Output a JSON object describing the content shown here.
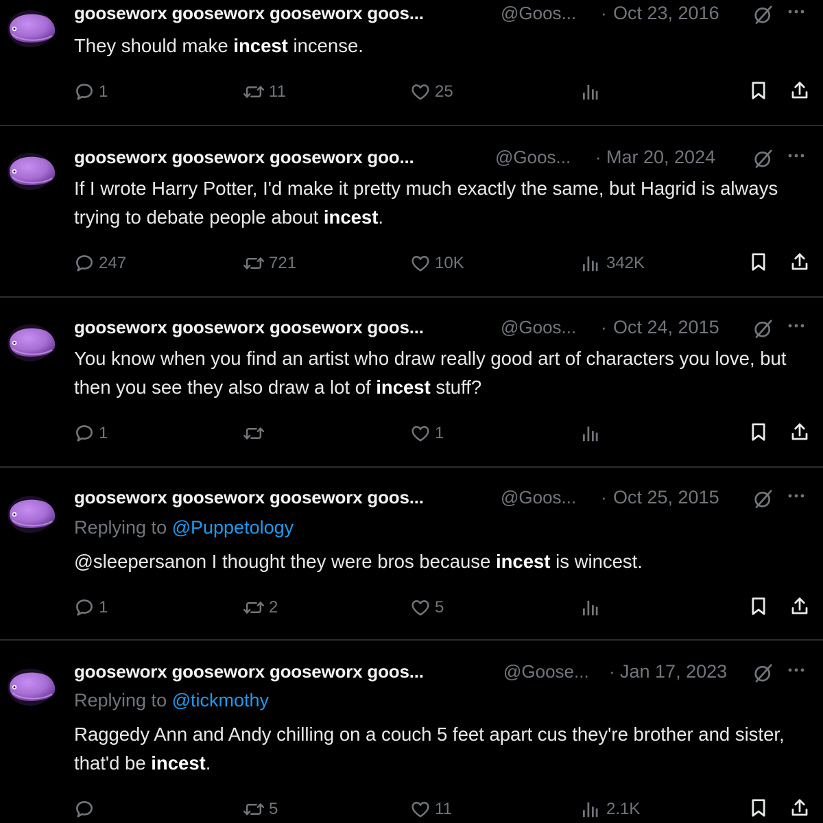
{
  "colors": {
    "background": "#000000",
    "text": "#e7e9ea",
    "muted": "#71767b",
    "link": "#1d9bf0",
    "divider": "#2a2d31",
    "avatar": "#a66dd4"
  },
  "tweets": [
    {
      "name": "gooseworx gooseworx gooseworx goos...",
      "handle": "@Goos...",
      "separator": "·",
      "date": "Oct 23, 2016",
      "text": {
        "before": "They should make ",
        "bold": "incest",
        "after": " incense."
      },
      "replies": "1",
      "reposts": "11",
      "likes": "25",
      "views": "",
      "icons": [
        "comment-icon",
        "repost-icon",
        "heart-icon",
        "views-icon",
        "bookmark-icon",
        "share-icon"
      ]
    },
    {
      "name": "gooseworx gooseworx gooseworx goo...",
      "handle": "@Goos...",
      "separator": "·",
      "date": "Mar 20, 2024",
      "text": {
        "before": "If I wrote Harry Potter, I'd make it pretty much exactly the same, but Hagrid is always trying to debate people about ",
        "bold": "incest",
        "after": "."
      },
      "replies": "247",
      "reposts": "721",
      "likes": "10K",
      "views": "342K"
    },
    {
      "name": "gooseworx gooseworx gooseworx goos...",
      "handle": "@Goos...",
      "separator": "·",
      "date": "Oct 24, 2015",
      "text": {
        "before": "You know when you find an artist who draw really good art of characters you love, but then you see they also draw a lot of ",
        "bold": "incest",
        "after": " stuff?"
      },
      "replies": "1",
      "reposts": "",
      "likes": "1",
      "views": ""
    },
    {
      "name": "gooseworx gooseworx gooseworx goos...",
      "handle": "@Goos...",
      "separator": "·",
      "date": "Oct 25, 2015",
      "reply_label": "Replying to ",
      "reply_mention": "@Puppetology",
      "text": {
        "before": "@sleepersanon I thought they were bros because ",
        "bold": "incest",
        "after": " is wincest."
      },
      "replies": "1",
      "reposts": "2",
      "likes": "5",
      "views": ""
    },
    {
      "name": "gooseworx gooseworx gooseworx goos...",
      "handle": "@Goose...",
      "separator": "·",
      "date": "Jan 17, 2023",
      "reply_label": "Replying to ",
      "reply_mention": "@tickmothy",
      "text": {
        "before": "Raggedy Ann and Andy chilling on a couch 5 feet apart cus they're brother and sister, that'd be ",
        "bold": "incest",
        "after": "."
      },
      "replies": "",
      "reposts": "5",
      "likes": "11",
      "views": "2.1K"
    }
  ]
}
